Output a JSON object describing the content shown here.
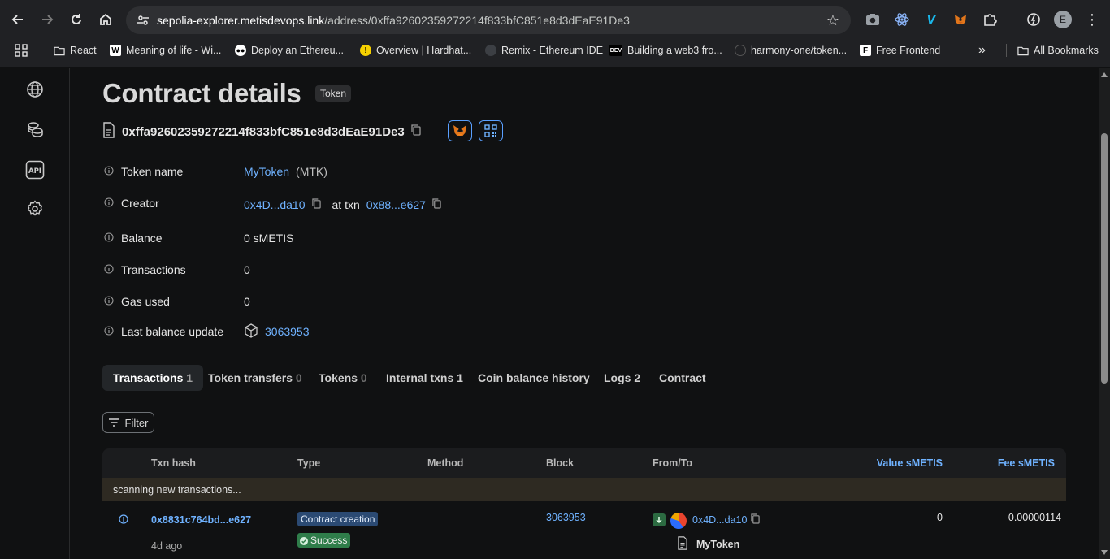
{
  "browser": {
    "url_host": "sepolia-explorer.metisdevops.link",
    "url_path": "/address/0xffa92602359272214f833bfC851e8d3dEaE91De3",
    "bookmarks": [
      {
        "label": "React",
        "icon": "folder-icon"
      },
      {
        "label": "Meaning of life - Wi...",
        "icon": "wikipedia-icon"
      },
      {
        "label": "Deploy an Ethereu...",
        "icon": "medium-icon"
      },
      {
        "label": "Overview | Hardhat...",
        "icon": "hardhat-icon"
      },
      {
        "label": "Remix - Ethereum IDE",
        "icon": "remix-icon"
      },
      {
        "label": "Building a web3 fro...",
        "icon": "dev-icon"
      },
      {
        "label": "harmony-one/token...",
        "icon": "github-icon"
      },
      {
        "label": "Free Frontend",
        "icon": "freefrontend-icon"
      }
    ],
    "bookmarks_overflow": "»",
    "all_bookmarks": "All Bookmarks",
    "profile_initial": "E"
  },
  "page": {
    "title": "Contract details",
    "badge": "Token",
    "address": "0xffa92602359272214f833bfC851e8d3dEaE91De3"
  },
  "details": {
    "token_name_label": "Token name",
    "token_name": "MyToken",
    "token_symbol": "(MTK)",
    "creator_label": "Creator",
    "creator": "0x4D...da10",
    "at_txn": "at txn",
    "creator_txn": "0x88...e627",
    "balance_label": "Balance",
    "balance": "0 sMETIS",
    "transactions_label": "Transactions",
    "transactions": "0",
    "gas_used_label": "Gas used",
    "gas_used": "0",
    "last_balance_label": "Last balance update",
    "last_balance_block": "3063953"
  },
  "tabs": [
    {
      "label": "Transactions",
      "count": "1"
    },
    {
      "label": "Token transfers",
      "count": "0"
    },
    {
      "label": "Tokens",
      "count": "0"
    },
    {
      "label": "Internal txns",
      "count": "1"
    },
    {
      "label": "Coin balance history",
      "count": ""
    },
    {
      "label": "Logs",
      "count": "2"
    },
    {
      "label": "Contract",
      "count": ""
    }
  ],
  "filter_label": "Filter",
  "table": {
    "headers": {
      "txn_hash": "Txn hash",
      "type": "Type",
      "method": "Method",
      "block": "Block",
      "from_to": "From/To",
      "value": "Value sMETIS",
      "fee": "Fee sMETIS"
    },
    "scanning": "scanning new transactions...",
    "rows": [
      {
        "hash": "0x8831c764bd...e627",
        "age": "4d ago",
        "type": "Contract creation",
        "status": "Success",
        "block": "3063953",
        "from": "0x4D...da10",
        "to": "MyToken",
        "value": "0",
        "fee": "0.00000114"
      }
    ]
  },
  "colors": {
    "accent": "#6fb2ff",
    "success": "#2f7d4a",
    "contract_creation": "#2b4a73"
  }
}
